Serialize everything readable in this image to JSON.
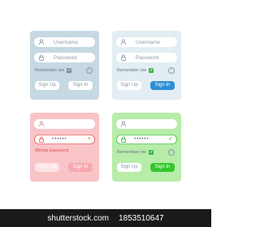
{
  "username_placeholder": "Username",
  "password_placeholder": "Password",
  "password_mask": "••••••",
  "remember_label": "Remember me",
  "wrong_password": "Wrong password",
  "signup_label": "Sign Up",
  "signin_label": "Sign In",
  "clear_glyph": "×",
  "valid_glyph": "✓",
  "info_glyph": "i",
  "check_glyph": "✓",
  "colors": {
    "card_default": "#c6d8e2",
    "card_light": "#e2eef3",
    "card_error": "#f9c4c8",
    "card_success": "#b8eca9",
    "signin_blue": "#2e8fd6",
    "signin_green": "#35c62d",
    "error_red": "#e74c4c"
  },
  "footer": {
    "watermark": "shutterstock.com",
    "id": "1853510647"
  }
}
